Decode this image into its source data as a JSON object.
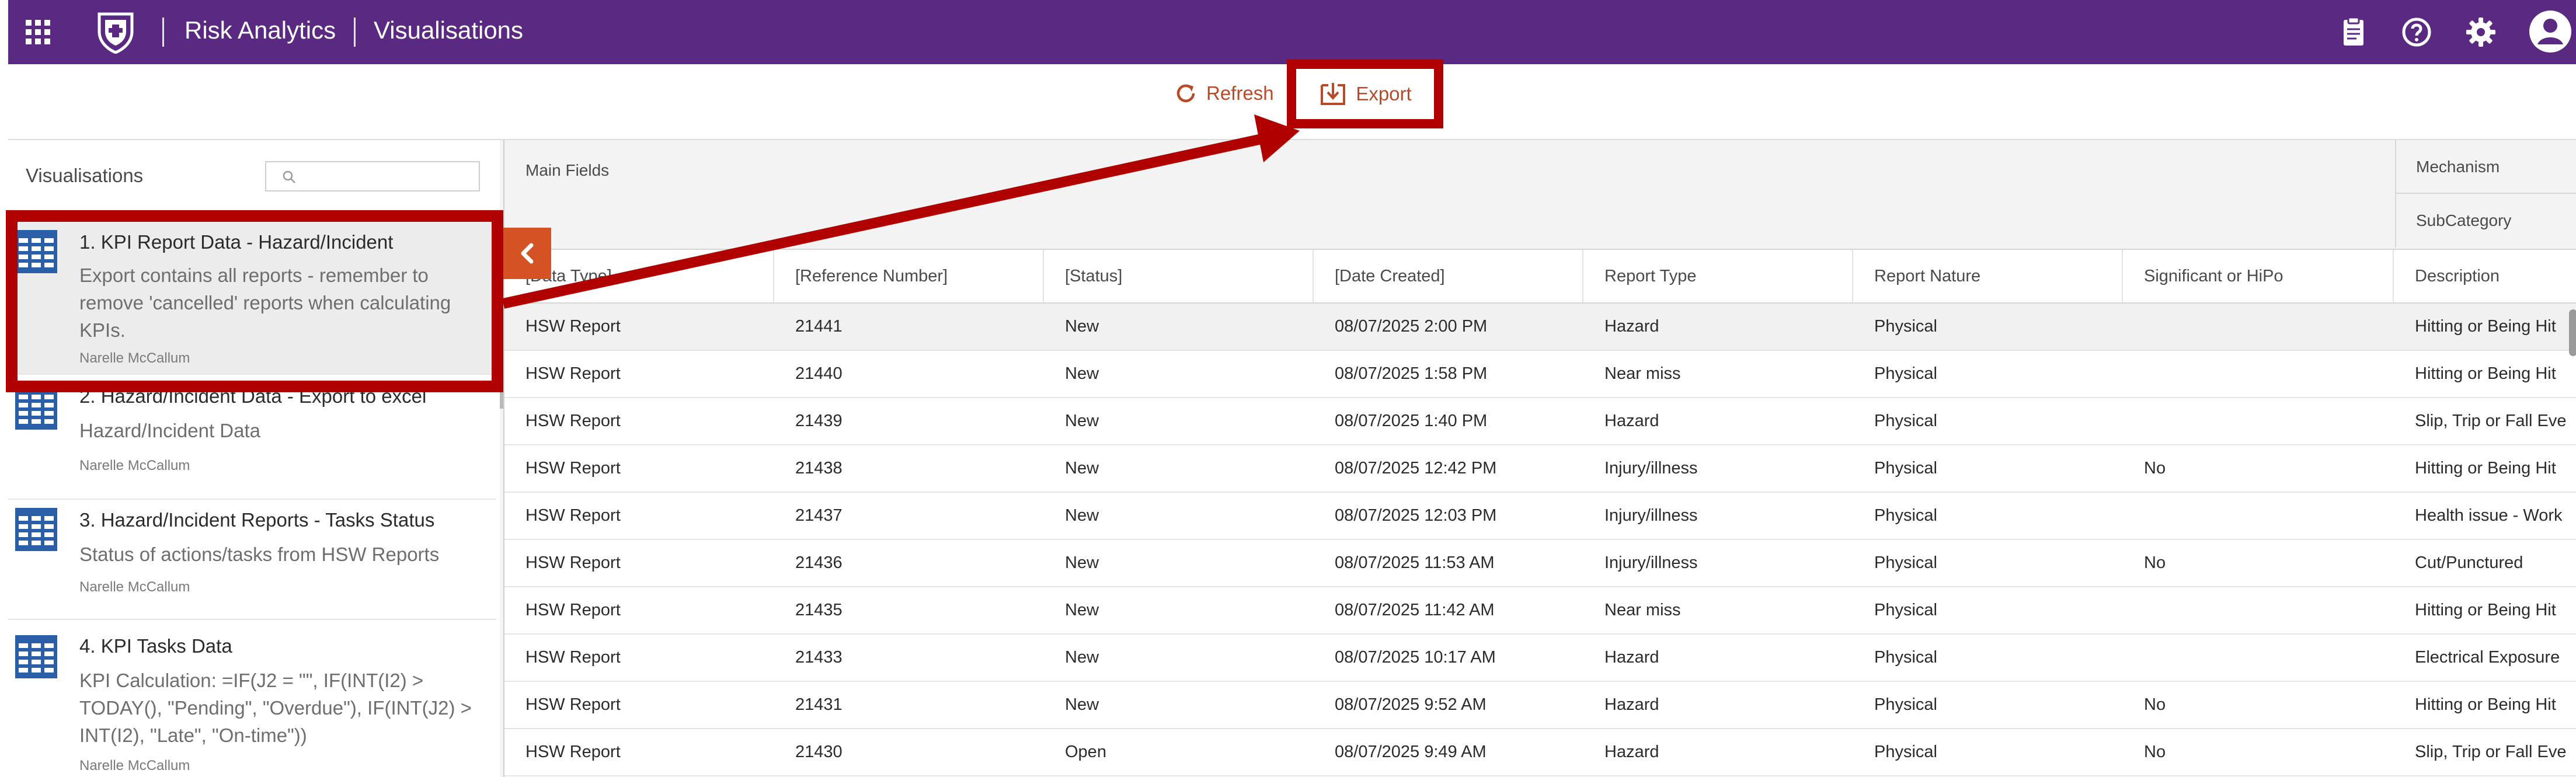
{
  "app": {
    "brand": "Risk Analytics",
    "section": "Visualisations"
  },
  "toolbar": {
    "refresh_label": "Refresh",
    "export_label": "Export"
  },
  "left_panel": {
    "title": "Visualisations",
    "search_placeholder": "",
    "items": [
      {
        "title": "1. KPI Report Data - Hazard/Incident",
        "description": "Export contains all reports - remember to remove 'cancelled' reports when calculating KPIs.",
        "author": "Narelle McCallum"
      },
      {
        "title": "2. Hazard/Incident Data - Export to excel",
        "description": "Hazard/Incident Data",
        "author": "Narelle McCallum"
      },
      {
        "title": "3. Hazard/Incident Reports - Tasks Status",
        "description": "Status of actions/tasks from HSW Reports",
        "author": "Narelle McCallum"
      },
      {
        "title": "4. KPI Tasks Data",
        "description": "KPI Calculation: =IF(J2 = \"\", IF(INT(I2) > TODAY(), \"Pending\", \"Overdue\"), IF(INT(J2) > INT(I2), \"Late\", \"On-time\"))",
        "author": "Narelle McCallum"
      }
    ]
  },
  "grid": {
    "pivot_main": "Main Fields",
    "pivot_mechanism": "Mechanism",
    "pivot_subcategory": "SubCategory",
    "columns": [
      "[Data Type]",
      "[Reference Number]",
      "[Status]",
      "[Date Created]",
      "Report Type",
      "Report Nature",
      "Significant or HiPo",
      "Description"
    ],
    "rows": [
      [
        "HSW Report",
        "21441",
        "New",
        "08/07/2025 2:00 PM",
        "Hazard",
        "Physical",
        "",
        "Hitting or Being Hit"
      ],
      [
        "HSW Report",
        "21440",
        "New",
        "08/07/2025 1:58 PM",
        "Near miss",
        "Physical",
        "",
        "Hitting or Being Hit"
      ],
      [
        "HSW Report",
        "21439",
        "New",
        "08/07/2025 1:40 PM",
        "Hazard",
        "Physical",
        "",
        "Slip, Trip or Fall Eve"
      ],
      [
        "HSW Report",
        "21438",
        "New",
        "08/07/2025 12:42 PM",
        "Injury/illness",
        "Physical",
        "No",
        "Hitting or Being Hit"
      ],
      [
        "HSW Report",
        "21437",
        "New",
        "08/07/2025 12:03 PM",
        "Injury/illness",
        "Physical",
        "",
        "Health issue - Work"
      ],
      [
        "HSW Report",
        "21436",
        "New",
        "08/07/2025 11:53 AM",
        "Injury/illness",
        "Physical",
        "No",
        "Cut/Punctured"
      ],
      [
        "HSW Report",
        "21435",
        "New",
        "08/07/2025 11:42 AM",
        "Near miss",
        "Physical",
        "",
        "Hitting or Being Hit"
      ],
      [
        "HSW Report",
        "21433",
        "New",
        "08/07/2025 10:17 AM",
        "Hazard",
        "Physical",
        "",
        "Electrical Exposure"
      ],
      [
        "HSW Report",
        "21431",
        "New",
        "08/07/2025 9:52 AM",
        "Hazard",
        "Physical",
        "No",
        "Hitting or Being Hit"
      ],
      [
        "HSW Report",
        "21430",
        "Open",
        "08/07/2025 9:49 AM",
        "Hazard",
        "Physical",
        "No",
        "Slip, Trip or Fall Eve"
      ]
    ]
  },
  "colors": {
    "header_purple": "#5a2a82",
    "accent_orange": "#d45224",
    "annotation_red": "#b00000"
  },
  "icons": [
    "app-launcher-icon",
    "crest-logo",
    "clipboard-icon",
    "help-icon",
    "settings-icon",
    "account-icon",
    "refresh-icon",
    "export-icon",
    "search-icon",
    "table-icon",
    "chevron-left-icon"
  ]
}
